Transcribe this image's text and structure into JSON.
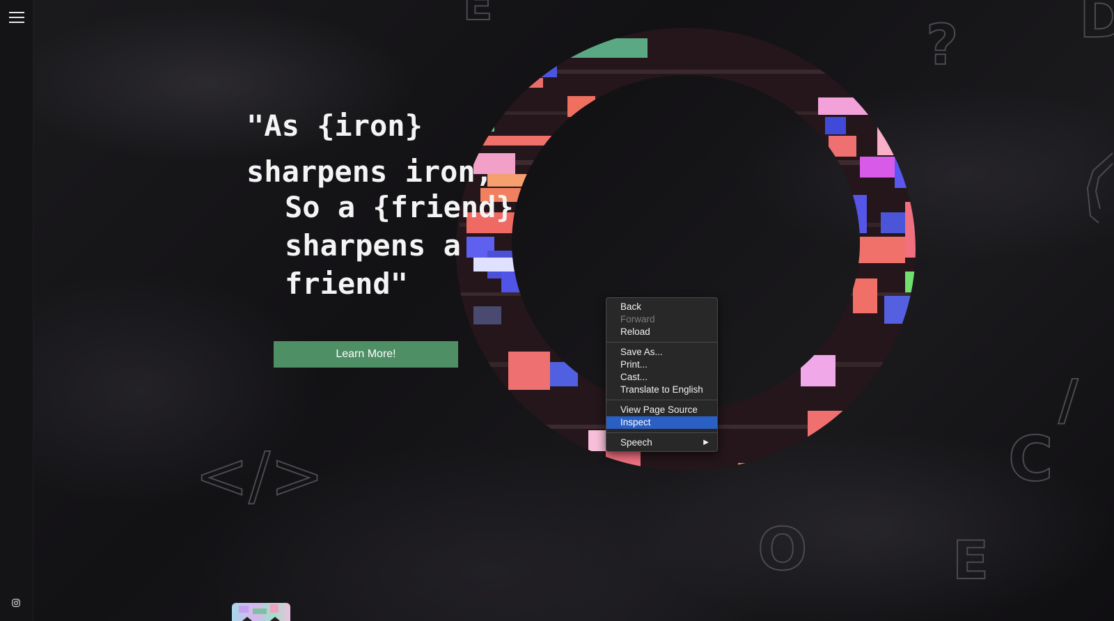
{
  "sidebar": {
    "menu_icon": "hamburger-menu-icon",
    "social_icon": "instagram-icon"
  },
  "hero": {
    "quote_line_1": "\"As {iron}",
    "quote_line_2": "sharpens iron,",
    "quote_line_3": "So a {friend}",
    "quote_line_4": "sharpens a",
    "quote_line_5": "friend\"",
    "cta_label": "Learn More!",
    "cta_color": "#4f8f66"
  },
  "decor_letters": {
    "top_e": "E",
    "top_question": "?",
    "top_right_d": "D",
    "right_c": "C",
    "bottom_o": "O",
    "bottom_e": "E",
    "slash": "/",
    "code_tag": "</>"
  },
  "context_menu": {
    "items": [
      {
        "label": "Back",
        "enabled": true
      },
      {
        "label": "Forward",
        "enabled": false
      },
      {
        "label": "Reload",
        "enabled": true
      },
      {
        "label": "Save As...",
        "enabled": true
      },
      {
        "label": "Print...",
        "enabled": true
      },
      {
        "label": "Cast...",
        "enabled": true
      },
      {
        "label": "Translate to English",
        "enabled": true
      },
      {
        "label": "View Page Source",
        "enabled": true
      },
      {
        "label": "Inspect",
        "enabled": true,
        "highlighted": true
      },
      {
        "label": "Speech",
        "enabled": true,
        "submenu": true
      }
    ],
    "submenu_arrow": "▶",
    "highlight_color": "#2a5fc4"
  }
}
